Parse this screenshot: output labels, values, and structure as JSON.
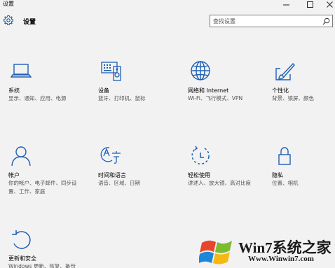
{
  "window": {
    "title": "设置",
    "minimize_glyph": "—",
    "maximize_glyph": "☐",
    "close_glyph": "✕"
  },
  "header": {
    "title": "设置",
    "icon": "gear-icon",
    "search_placeholder": "查找设置",
    "search_icon": "search-icon"
  },
  "accent_color": "#1e5fb4",
  "tiles": [
    {
      "name": "系统",
      "desc": "显示、通知、应用、电源",
      "icon": "laptop-icon"
    },
    {
      "name": "设备",
      "desc": "蓝牙、打印机、鼠标",
      "icon": "devices-icon"
    },
    {
      "name": "网络和 Internet",
      "desc": "Wi-Fi、飞行模式、VPN",
      "icon": "globe-icon"
    },
    {
      "name": "个性化",
      "desc": "背景、锁屏、颜色",
      "icon": "paintbrush-icon"
    },
    {
      "name": "帐户",
      "desc": "你的帐户、电子邮件、同步设置、工作、家庭",
      "icon": "person-icon"
    },
    {
      "name": "时间和语言",
      "desc": "语音、区域、日期",
      "icon": "time-language-icon"
    },
    {
      "name": "轻松使用",
      "desc": "讲述人、放大镜、高对比度",
      "icon": "ease-of-access-icon"
    },
    {
      "name": "隐私",
      "desc": "位置、相机",
      "icon": "lock-icon"
    },
    {
      "name": "更新和安全",
      "desc": "Windows 更新、恢复、备份",
      "icon": "update-icon"
    }
  ],
  "watermark": {
    "title": "Win7系统之家",
    "url": "Www.Winwin7.com"
  }
}
